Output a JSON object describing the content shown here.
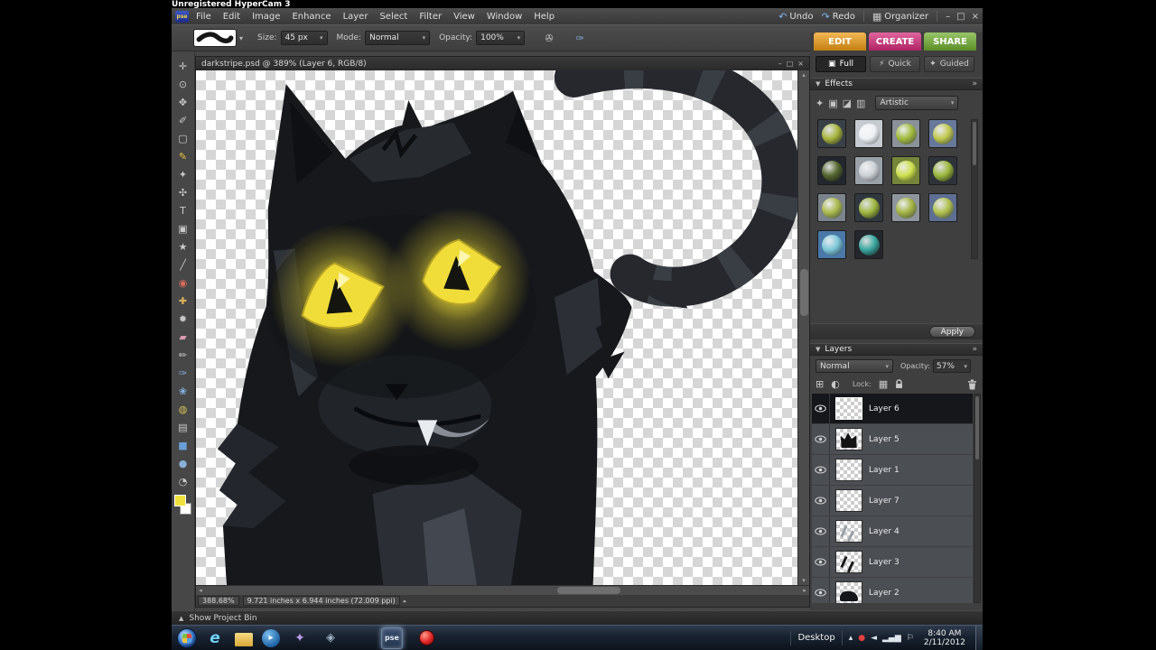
{
  "watermark": "Unregistered HyperCam 3",
  "ui": {
    "dropdown_arrow": "▾",
    "collapse_icon": "▼",
    "panel_menu_icon": "»",
    "scroll_up": "▴",
    "scroll_down": "▾",
    "scroll_left": "◂",
    "scroll_right": "▸"
  },
  "menu_bar": {
    "logo": "pse",
    "items": [
      "File",
      "Edit",
      "Image",
      "Enhance",
      "Layer",
      "Select",
      "Filter",
      "View",
      "Window",
      "Help"
    ],
    "undo_icon": "↶",
    "redo_icon": "↷",
    "undo": "Undo",
    "redo": "Redo",
    "organizer_icon": "▦",
    "organizer": "Organizer",
    "window_controls": [
      "–",
      "□",
      "×"
    ]
  },
  "options_bar": {
    "size_label": "Size:",
    "size_value": "45 px",
    "mode_label": "Mode:",
    "mode_value": "Normal",
    "opacity_label": "Opacity:",
    "opacity_value": "100%",
    "icons": [
      {
        "name": "airbrush-icon",
        "glyph": "✇"
      },
      {
        "name": "brush-settings-icon",
        "glyph": "✑",
        "color": "#86b2e0"
      }
    ]
  },
  "mode_tabs": [
    {
      "name": "tab-edit",
      "label": "EDIT",
      "color": "#ee9c14"
    },
    {
      "name": "tab-create",
      "label": "CREATE",
      "color": "#d52a7a"
    },
    {
      "name": "tab-share",
      "label": "SHARE",
      "color": "#6fae2f"
    }
  ],
  "edit_modes": [
    {
      "name": "edit-mode-full",
      "label": "Full",
      "glyph": "▣",
      "active": true
    },
    {
      "name": "edit-mode-quick",
      "label": "Quick",
      "glyph": "⚡"
    },
    {
      "name": "edit-mode-guided",
      "label": "Guided",
      "glyph": "✦"
    }
  ],
  "effects": {
    "title": "Effects",
    "category_icons": [
      {
        "name": "filters-category-icon",
        "glyph": "✦"
      },
      {
        "name": "layer-styles-category-icon",
        "glyph": "▣"
      },
      {
        "name": "photo-effects-category-icon",
        "glyph": "◪"
      },
      {
        "name": "all-effects-category-icon",
        "glyph": "▥"
      }
    ],
    "category_value": "Artistic",
    "apply_label": "Apply",
    "thumbs": [
      {
        "name": "effect-thumb",
        "bg": "#3a4047",
        "ball": "#a8b63e"
      },
      {
        "name": "effect-thumb",
        "bg": "#c6cbd1",
        "ball": "#eef2f5"
      },
      {
        "name": "effect-thumb",
        "bg": "#8b9199",
        "ball": "#a2ba3c"
      },
      {
        "name": "effect-thumb",
        "bg": "#67789a",
        "ball": "#c2c94e"
      },
      {
        "name": "effect-thumb",
        "bg": "#23262c",
        "ball": "#55662e"
      },
      {
        "name": "effect-thumb",
        "bg": "#9aa1a9",
        "ball": "#ccd1d6"
      },
      {
        "name": "effect-thumb",
        "bg": "#75853a",
        "ball": "#cde04e"
      },
      {
        "name": "effect-thumb",
        "bg": "#2e333a",
        "ball": "#9cb83c"
      },
      {
        "name": "effect-thumb",
        "bg": "#7b838d",
        "ball": "#a9b94c"
      },
      {
        "name": "effect-thumb",
        "bg": "#31373e",
        "ball": "#9eb73e"
      },
      {
        "name": "effect-thumb",
        "bg": "#8e959d",
        "ball": "#a3b442"
      },
      {
        "name": "effect-thumb",
        "bg": "#5d6e92",
        "ball": "#b1c14c"
      },
      {
        "name": "effect-thumb",
        "bg": "#4a78a8",
        "ball": "#7ec8d8"
      },
      {
        "name": "effect-thumb",
        "bg": "#23262b",
        "ball": "#3aa8a0"
      }
    ]
  },
  "layers_panel": {
    "title": "Layers",
    "blend_mode": "Normal",
    "opacity_label": "Opacity:",
    "opacity_value": "57%",
    "new_layer_icon": "⊞",
    "adjustment_icon": "◐",
    "lock_label": "Lock:",
    "lock_transparency_icon": "▦",
    "layers": [
      {
        "name": "layer-row-6",
        "label": "Layer 6",
        "selected": true,
        "thumb": "blank"
      },
      {
        "name": "layer-row-5",
        "label": "Layer 5",
        "thumb": "cat"
      },
      {
        "name": "layer-row-1",
        "label": "Layer 1",
        "thumb": "blank"
      },
      {
        "name": "layer-row-7",
        "label": "Layer 7",
        "thumb": "blank"
      },
      {
        "name": "layer-row-4",
        "label": "Layer 4",
        "thumb": "marks-light"
      },
      {
        "name": "layer-row-3",
        "label": "Layer 3",
        "thumb": "marks"
      },
      {
        "name": "layer-row-2",
        "label": "Layer 2",
        "thumb": "blob"
      }
    ]
  },
  "document": {
    "title": "darkstripe.psd @ 389% (Layer 6, RGB/8)",
    "zoom": "388.68%",
    "dimensions": "9.721 inches x 6.944 inches (72.009 ppi)"
  },
  "project_bin": {
    "icon": "▲",
    "label": "Show Project Bin"
  },
  "tools": [
    {
      "name": "move-tool",
      "glyph": "✛"
    },
    {
      "name": "zoom-tool",
      "glyph": "⊙"
    },
    {
      "name": "hand-tool",
      "glyph": "✥"
    },
    {
      "name": "eyedropper-tool",
      "glyph": "✐"
    },
    {
      "name": "marquee-tool",
      "glyph": "▢"
    },
    {
      "name": "lasso-tool",
      "glyph": "✎",
      "color": "#e6c23c"
    },
    {
      "name": "magic-wand-tool",
      "glyph": "✦"
    },
    {
      "name": "quick-selection-tool",
      "glyph": "✣"
    },
    {
      "name": "type-tool",
      "glyph": "T"
    },
    {
      "name": "crop-tool",
      "glyph": "▣"
    },
    {
      "name": "cookie-cutter-tool",
      "glyph": "★"
    },
    {
      "name": "straighten-tool",
      "glyph": "╱"
    },
    {
      "name": "red-eye-tool",
      "glyph": "◉",
      "color": "#d86a5a"
    },
    {
      "name": "healing-brush-tool",
      "glyph": "✚",
      "color": "#d8b05a"
    },
    {
      "name": "clone-stamp-tool",
      "glyph": "✹"
    },
    {
      "name": "eraser-tool",
      "glyph": "▰",
      "color": "#d89ab0"
    },
    {
      "name": "pencil-tool",
      "glyph": "✏"
    },
    {
      "name": "brush-tool",
      "glyph": "✑",
      "color": "#86b2e0"
    },
    {
      "name": "smart-brush-tool",
      "glyph": "❀",
      "color": "#86b2e0"
    },
    {
      "name": "paint-bucket-tool",
      "glyph": "◍",
      "color": "#d8c05a"
    },
    {
      "name": "gradient-tool",
      "glyph": "▤"
    },
    {
      "name": "shape-tool",
      "glyph": "■",
      "color": "#6a9fd8"
    },
    {
      "name": "blur-tool",
      "glyph": "●",
      "color": "#8ab0d8"
    },
    {
      "name": "sponge-tool",
      "glyph": "◔"
    }
  ],
  "taskbar": {
    "desktop_label": "Desktop",
    "time": "8:40 AM",
    "date": "2/11/2012",
    "icons": [
      {
        "name": "ie-taskbar-icon",
        "glyph": "e",
        "kind": "ie"
      },
      {
        "name": "explorer-taskbar-icon",
        "glyph": "",
        "kind": "folder"
      },
      {
        "name": "media-player-taskbar-icon",
        "glyph": "▸",
        "kind": "wmp"
      },
      {
        "name": "app-taskbar-icon-1",
        "glyph": "✦",
        "kind": "app1"
      },
      {
        "name": "app-taskbar-icon-2",
        "glyph": "◈",
        "kind": "app2"
      },
      {
        "name": "pse-taskbar-button",
        "glyph": "pse",
        "kind": "pse",
        "active": true,
        "gap": 34
      },
      {
        "name": "hypercam-record-button",
        "glyph": "",
        "kind": "record",
        "gap": 8
      }
    ],
    "tray_icons": [
      {
        "name": "hidden-icons-chevron",
        "glyph": "▴"
      },
      {
        "name": "hypercam-tray-icon",
        "glyph": "●",
        "color": "#e04040"
      },
      {
        "name": "volume-icon",
        "glyph": "◄"
      },
      {
        "name": "network-icon",
        "glyph": "▂▄▆"
      },
      {
        "name": "action-center-icon",
        "glyph": "⚐"
      }
    ]
  }
}
